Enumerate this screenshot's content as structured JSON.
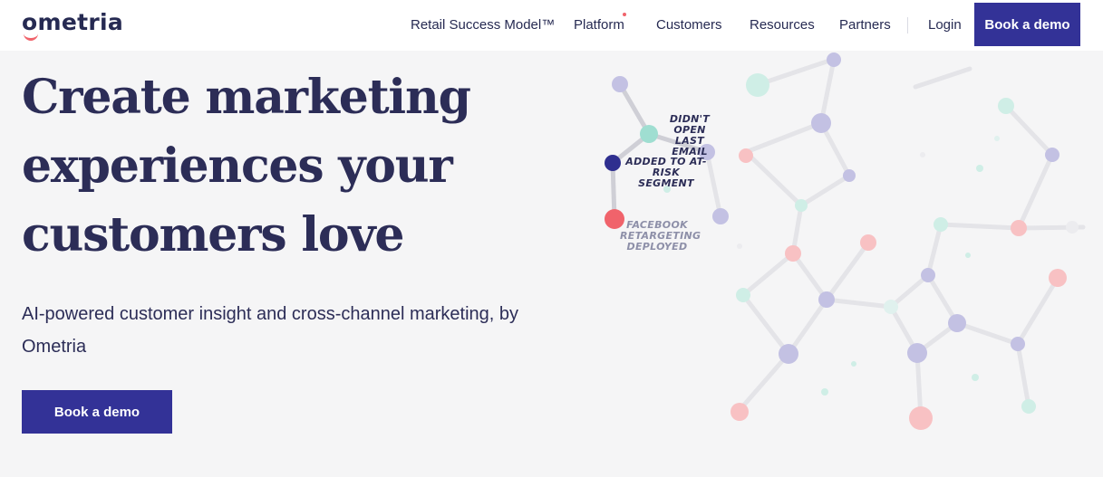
{
  "brand": {
    "logo_text": "ometria"
  },
  "nav": {
    "items": [
      {
        "label": "Retail Success Model™"
      },
      {
        "label": "Platform"
      },
      {
        "label": "Customers"
      },
      {
        "label": "Resources"
      },
      {
        "label": "Partners"
      }
    ],
    "login": "Login",
    "cta": "Book a demo"
  },
  "hero": {
    "title_lines": [
      "Create marketing",
      "experiences your",
      "customers love"
    ],
    "subtitle_lines": [
      "AI-powered customer insight and cross-channel marketing, by",
      "Ometria"
    ],
    "cta": "Book a demo"
  },
  "graphic": {
    "annotations": {
      "email": [
        "DIDN'T OPEN",
        "LAST EMAIL"
      ],
      "segment": [
        "ADDED TO AT-",
        "RISK SEGMENT"
      ],
      "facebook": [
        "FACEBOOK",
        "RETARGETING",
        "DEPLOYED"
      ]
    }
  },
  "colors": {
    "brand_navy": "#2c2d57",
    "button_indigo": "#333297",
    "accent_coral": "#f0636b",
    "node_lavender": "#c3c1e3",
    "node_mint": "#b7e6da",
    "node_pink": "#f8c1c3",
    "background": "#f5f5f6"
  }
}
